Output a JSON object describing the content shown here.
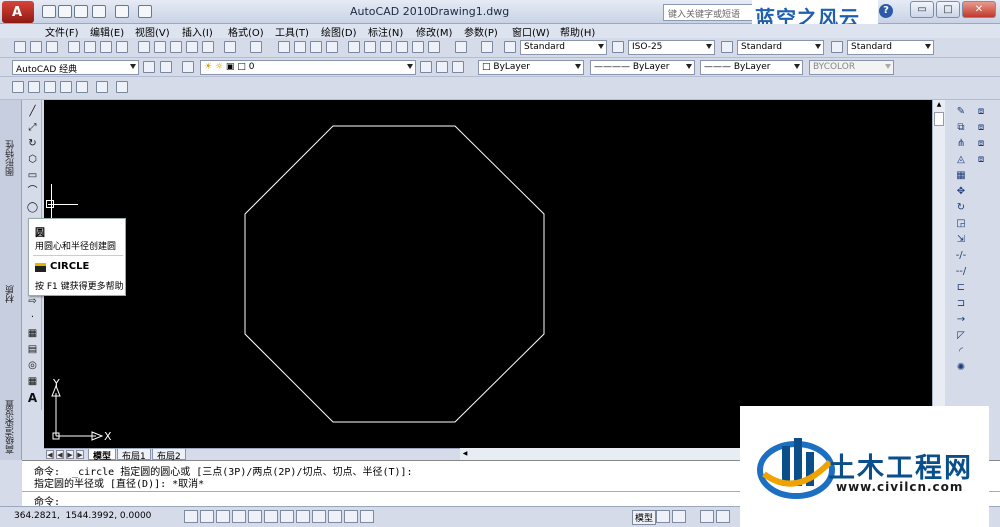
{
  "window": {
    "app_title": "AutoCAD 2010",
    "document": "Drawing1.dwg",
    "search_placeholder": "键入关键字或短语",
    "help": "?",
    "min": "▭",
    "restore": "□",
    "close": "✕"
  },
  "brand_overlay": "蓝空之风云",
  "menu": [
    "文件(F)",
    "编辑(E)",
    "视图(V)",
    "插入(I)",
    "格式(O)",
    "工具(T)",
    "绘图(D)",
    "标注(N)",
    "修改(M)",
    "参数(P)",
    "窗口(W)",
    "帮助(H)"
  ],
  "styles": {
    "text_style": "Standard",
    "dim_style": "ISO-25",
    "table_style": "Standard",
    "multileader_style": "Standard"
  },
  "workspace": "AutoCAD 经典",
  "layer": "0",
  "properties": {
    "color": "ByLayer",
    "linetype": "ByLayer",
    "lineweight": "ByLayer",
    "plotstyle": "BYCOLOR"
  },
  "palette_tabs": [
    "图形特性",
    "材质",
    "高级渲染设置"
  ],
  "tooltip": {
    "title": "圆",
    "description": "用圆心和半径创建圆",
    "command": "CIRCLE",
    "help": "按 F1 键获得更多帮助"
  },
  "drawing": {
    "shape": "octagon",
    "stroke_color": "#ffffff",
    "ucs_x_label": "X",
    "ucs_y_label": "Y"
  },
  "layout_tabs": [
    "模型",
    "布局1",
    "布局2"
  ],
  "command_history": [
    "命令:  _circle 指定圆的圆心或 [三点(3P)/两点(2P)/切点、切点、半径(T)]:",
    "指定圆的半径或 [直径(D)]: *取消*"
  ],
  "command_prompt": "命令:",
  "status": {
    "coordinates": "364.2821,  1544.3992, 0.0000",
    "model_label": "模型"
  },
  "watermark": {
    "name": "土木工程网",
    "url": "www.civilcn.com"
  }
}
